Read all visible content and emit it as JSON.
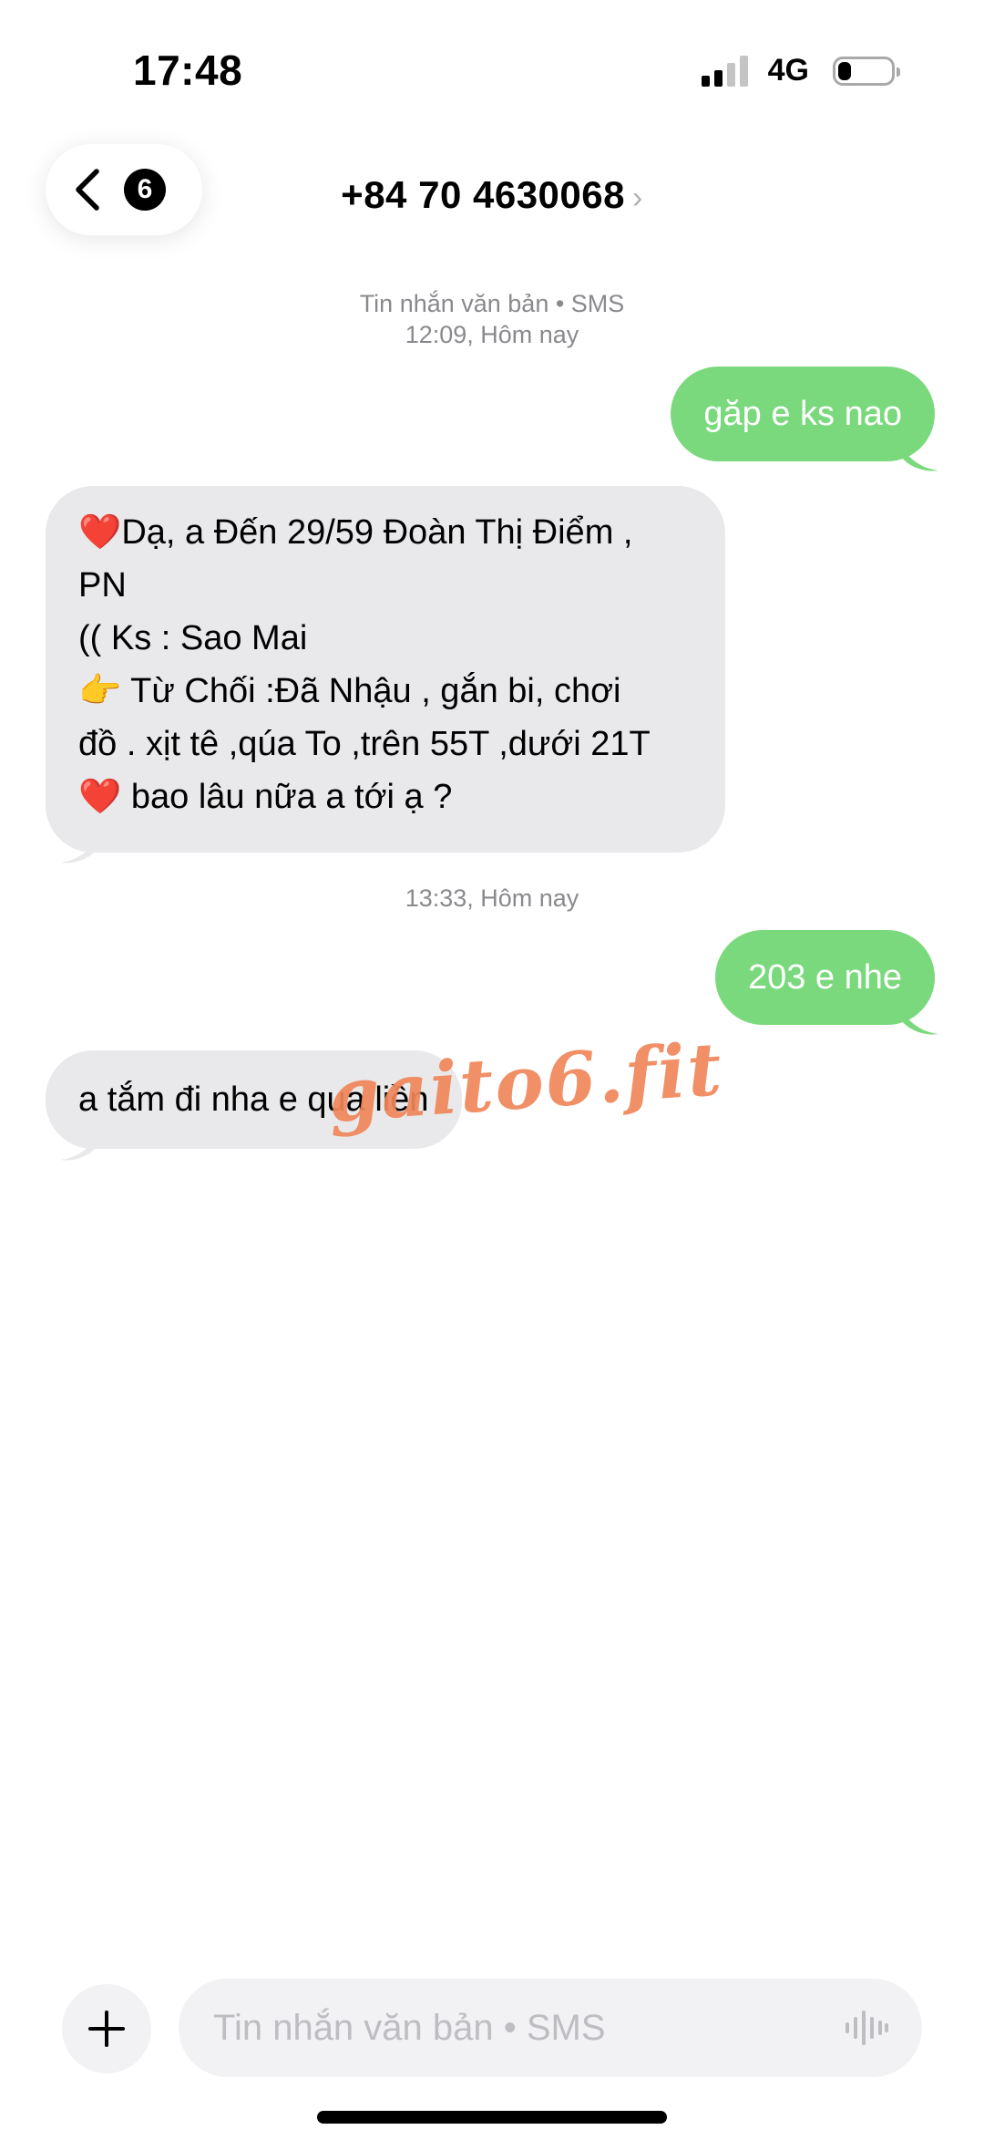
{
  "status_bar": {
    "time": "17:48",
    "network": "4G",
    "battery_level": 0.25
  },
  "header": {
    "unread_count": "6",
    "contact": "+84 70 4630068",
    "chevron": "›"
  },
  "messages": [
    {
      "type": "timestamp",
      "line1": "Tin nhắn văn bản • SMS",
      "line2": "12:09, Hôm nay"
    },
    {
      "type": "outgoing",
      "text": "găp e ks nao"
    },
    {
      "type": "incoming",
      "text": "❤️Dạ, a Đến 29/59 Đoàn Thị Điểm ,\nPN\n(( Ks :  Sao Mai\n👉 Từ Chối :Đã Nhậu , gắn bi, chơi\nđồ . xịt tê ,qúa To ,trên 55T ,dưới 21T\n❤️ bao lâu nữa a tới ạ ?"
    },
    {
      "type": "timestamp",
      "line1": "13:33, Hôm nay"
    },
    {
      "type": "outgoing",
      "text": "203 e nhe"
    },
    {
      "type": "incoming",
      "text": "a tắm đi nha e qua liền"
    }
  ],
  "watermark": "gaito6.fit",
  "composer": {
    "placeholder": "Tin nhắn văn bản • SMS"
  },
  "icons": [
    "back-chevron-icon",
    "plus-icon",
    "waveform-icon",
    "signal-icon",
    "battery-icon"
  ]
}
